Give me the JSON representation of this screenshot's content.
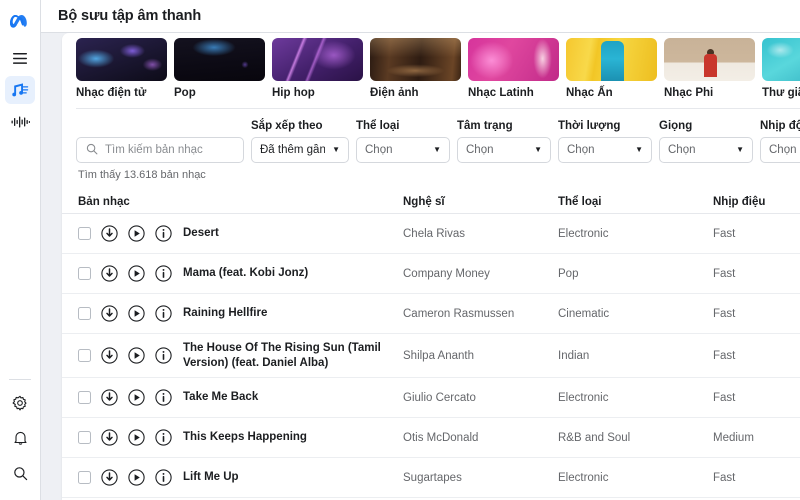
{
  "header": {
    "title": "Bộ sưu tập âm thanh"
  },
  "rail": {
    "logo": "meta-logo",
    "items": [
      {
        "icon": "hamburger-menu-icon",
        "name": "menu",
        "active": false
      },
      {
        "icon": "music-library-icon",
        "name": "sound-collection",
        "active": true
      },
      {
        "icon": "sound-wave-icon",
        "name": "audio-waveform",
        "active": false
      }
    ],
    "bottom_items": [
      {
        "icon": "gear-icon",
        "name": "settings"
      },
      {
        "icon": "bell-icon",
        "name": "notifications"
      },
      {
        "icon": "search-icon",
        "name": "search"
      }
    ]
  },
  "categories": [
    {
      "label": "Nhạc điện tử",
      "art": "art-electronic"
    },
    {
      "label": "Pop",
      "art": "art-pop"
    },
    {
      "label": "Hip hop",
      "art": "art-hiphop"
    },
    {
      "label": "Điện ảnh",
      "art": "art-cinematic"
    },
    {
      "label": "Nhạc Latinh",
      "art": "art-latin"
    },
    {
      "label": "Nhạc Ấn",
      "art": "art-indian"
    },
    {
      "label": "Nhạc Phi",
      "art": "art-african"
    },
    {
      "label": "Thư giãn",
      "art": "art-relax"
    }
  ],
  "filters": {
    "search": {
      "placeholder": "Tìm kiếm bản nhạc",
      "value": ""
    },
    "sort": {
      "label": "Sắp xếp theo",
      "value": "Đã thêm gần..."
    },
    "genre": {
      "label": "Thể loại",
      "value": "Chọn"
    },
    "mood": {
      "label": "Tâm trạng",
      "value": "Chọn"
    },
    "duration": {
      "label": "Thời lượng",
      "value": "Chọn"
    },
    "vocals": {
      "label": "Giọng",
      "value": "Chọn"
    },
    "tempo": {
      "label": "Nhịp độ",
      "value": "Chọn"
    }
  },
  "result_count": "Tìm thấy 13.618 bản nhạc",
  "table": {
    "columns": {
      "track": "Bản nhạc",
      "artist": "Nghệ sĩ",
      "genre": "Thể loại",
      "tempo": "Nhịp điệu"
    },
    "rows": [
      {
        "title": "Desert",
        "artist": "Chela Rivas",
        "genre": "Electronic",
        "tempo": "Fast",
        "tall": false
      },
      {
        "title": "Mama (feat. Kobi Jonz)",
        "artist": "Company Money",
        "genre": "Pop",
        "tempo": "Fast",
        "tall": false
      },
      {
        "title": "Raining Hellfire",
        "artist": "Cameron Rasmussen",
        "genre": "Cinematic",
        "tempo": "Fast",
        "tall": false
      },
      {
        "title": "The House Of The Rising Sun (Tamil Version) (feat. Daniel Alba)",
        "artist": "Shilpa Ananth",
        "genre": "Indian",
        "tempo": "Fast",
        "tall": true
      },
      {
        "title": "Take Me Back",
        "artist": "Giulio Cercato",
        "genre": "Electronic",
        "tempo": "Fast",
        "tall": false
      },
      {
        "title": "This Keeps Happening",
        "artist": "Otis McDonald",
        "genre": "R&B and Soul",
        "tempo": "Medium",
        "tall": false
      },
      {
        "title": "Lift Me Up",
        "artist": "Sugartapes",
        "genre": "Electronic",
        "tempo": "Fast",
        "tall": false
      }
    ],
    "row_icons": {
      "checkbox": "checkbox-icon",
      "download": "download-icon",
      "play": "play-icon",
      "info": "info-icon"
    }
  },
  "colors": {
    "accent": "#1877f2",
    "active_pill": "#e7f0fd",
    "page_bg": "#eef0f4",
    "card_bg": "#ffffff",
    "text_primary": "#1c1e21",
    "text_secondary": "#65676b"
  }
}
